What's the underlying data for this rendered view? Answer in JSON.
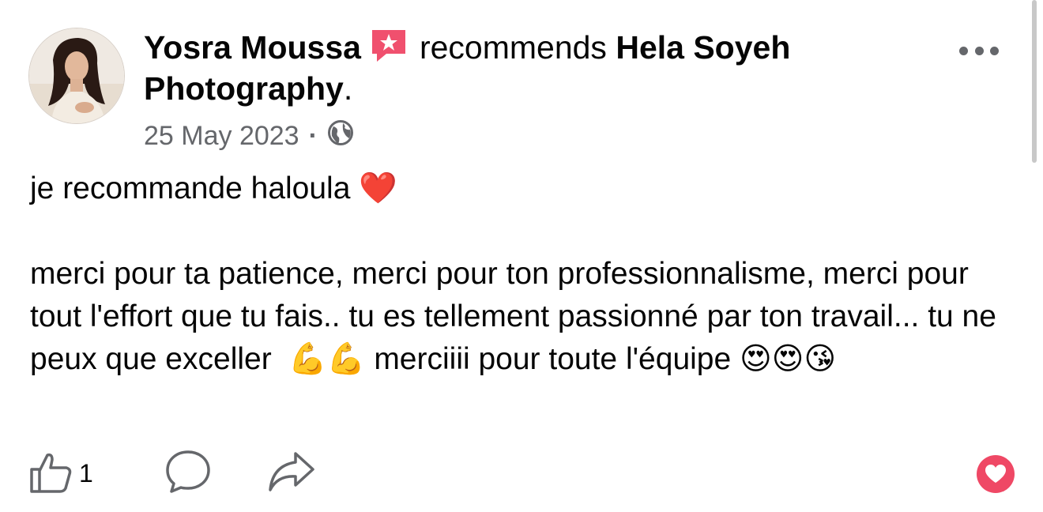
{
  "post": {
    "author": "Yosra Moussa",
    "action_text": "recommends",
    "page_name": "Hela Soyeh Photography",
    "period": ".",
    "date": "25 May 2023",
    "separator": "·",
    "audience_icon": "globe-icon",
    "body": "je recommande haloula ❤️\n\nmerci pour ta patience, merci pour ton professionnalisme, merci pour tout l'effort que tu fais.. tu es tellement passionné par ton travail... tu ne  peux que exceller  💪💪 merciiii pour toute l'équipe 😍😍😘"
  },
  "actions": {
    "like_count": "1",
    "like_icon": "thumbs-up-icon",
    "comment_icon": "comment-icon",
    "share_icon": "share-icon",
    "reaction_icon": "love-reaction-icon"
  },
  "colors": {
    "text": "#050505",
    "secondary": "#65676b",
    "recommend_badge": "#f0506e",
    "love": "#ef4865"
  }
}
